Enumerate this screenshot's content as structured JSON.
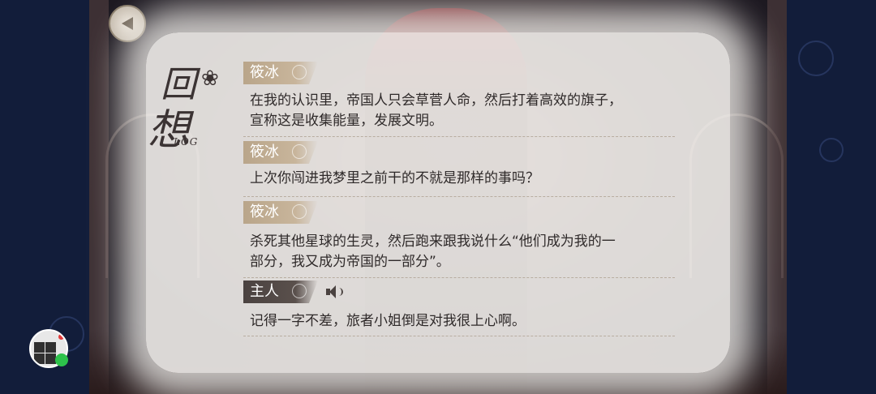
{
  "window": {
    "title_main": "回",
    "title_second": "想",
    "title_sub": "LOG"
  },
  "entries": [
    {
      "speaker": "筱冰",
      "text_lines": [
        "在我的认识里，帝国人只会草菅人命，然后打着高效的旗子，",
        "宣称这是收集能量，发展文明。"
      ],
      "voice": false
    },
    {
      "speaker": "筱冰",
      "text_lines": [
        "上次你闯进我梦里之前干的不就是那样的事吗？"
      ],
      "voice": false
    },
    {
      "speaker": "筱冰",
      "text_lines": [
        "杀死其他星球的生灵，然后跑来跟我说什么“他们成为我的一",
        "部分，我又成为帝国的一部分”。"
      ],
      "voice": false
    },
    {
      "speaker": "主人",
      "text_lines": [
        "记得一字不差，旅者小姐倒是对我很上心啊。"
      ],
      "voice": true
    }
  ],
  "icons": {
    "back": "back-arrow-icon",
    "voice": "speaker-icon",
    "butterfly": "butterfly-icon",
    "tag_ornament": "rose-icon"
  },
  "colors": {
    "tag_light": "#c8b59b",
    "tag_dark": "#4a4240",
    "panel": "#faf8f4",
    "text": "#2f2a2a"
  }
}
